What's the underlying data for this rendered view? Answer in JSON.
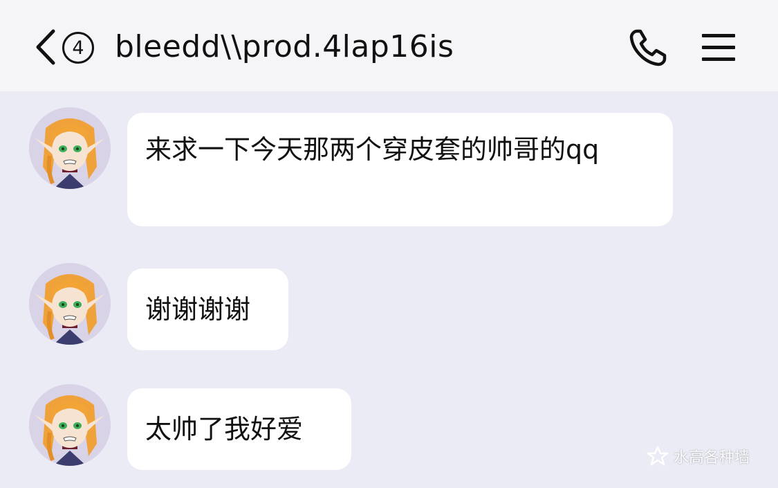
{
  "header": {
    "back_icon": "chevron-left-icon",
    "unread_count": "4",
    "title": "bleedd\\\\prod.4lap16is",
    "call_icon": "phone-icon",
    "menu_icon": "hamburger-menu-icon"
  },
  "messages": [
    {
      "text": "来求一下今天那两个穿皮套的帅哥的qq"
    },
    {
      "text": "谢谢谢谢"
    },
    {
      "text": "太帅了我好爱"
    }
  ],
  "watermark": {
    "text": "水高各种墙"
  },
  "colors": {
    "background": "#eaebf4",
    "header": "#f5f5f7",
    "bubble": "#ffffff",
    "text": "#111111"
  }
}
